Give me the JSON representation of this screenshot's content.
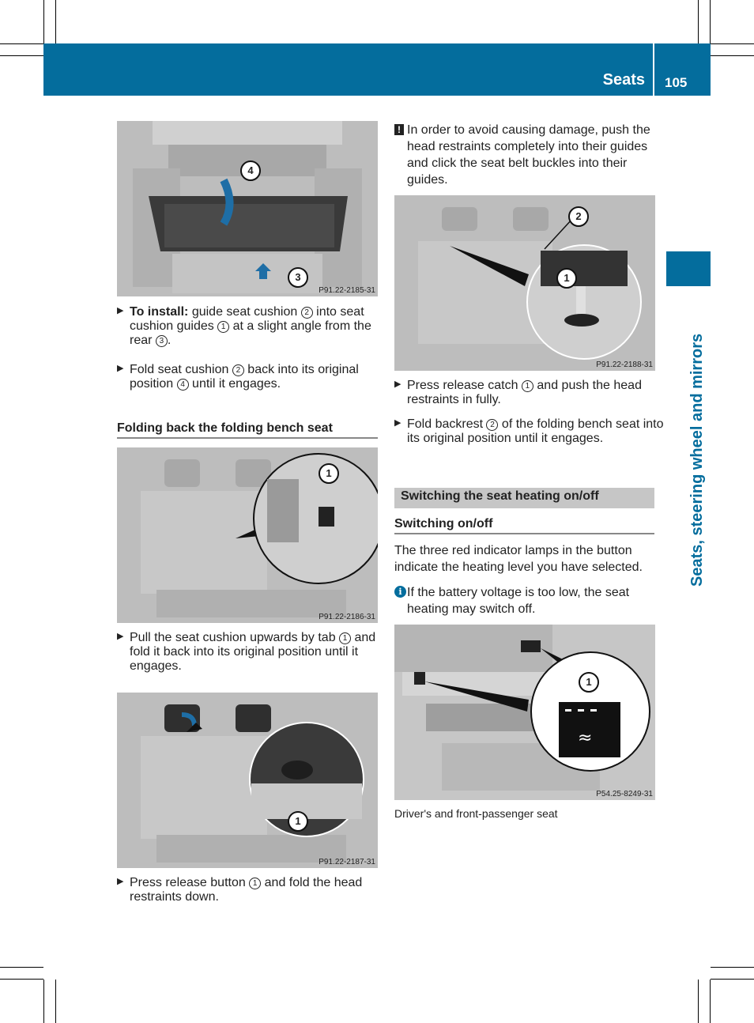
{
  "header": {
    "section_title": "Seats",
    "page_number": "105",
    "accent_color": "#046d9d"
  },
  "side_tab": {
    "chapter_label": "Seats, steering wheel and mirrors"
  },
  "left_column": {
    "figure1": {
      "code": "P91.22-2185-31",
      "callouts": [
        "4",
        "3"
      ],
      "description": "Luggage compartment with seat cushion being installed; curved blue arrow and upward blue arrow"
    },
    "install_steps": [
      {
        "bold_prefix": "To install:",
        "parts": [
          " guide seat cushion ",
          "2",
          " into seat cushion guides ",
          "1",
          " at a slight angle from the rear ",
          "3",
          "."
        ]
      },
      {
        "parts": [
          "Fold seat cushion ",
          "2",
          " back into its original position ",
          "4",
          " until it engages."
        ]
      }
    ],
    "heading_folding_back": "Folding back the folding bench seat",
    "figure2": {
      "code": "P91.22-2186-31",
      "callouts": [
        "1"
      ],
      "description": "Rear bench seat with magnified inset of tab"
    },
    "pull_step": {
      "parts": [
        "Pull the seat cushion upwards by tab ",
        "1",
        " and fold it back into its original position until it engages."
      ]
    },
    "figure3": {
      "code": "P91.22-2187-31",
      "callouts": [
        "1"
      ],
      "description": "Head restraint with blue arrow and magnified inset of release button"
    },
    "press_button_step": {
      "parts": [
        "Press release button ",
        "1",
        " and fold the head restraints down."
      ]
    }
  },
  "right_column": {
    "warning": {
      "icon": "exclamation-icon",
      "text": "In order to avoid causing damage, push the head restraints completely into their guides and click the seat belt buckles into their guides."
    },
    "figure4": {
      "code": "P91.22-2188-31",
      "callouts": [
        "2",
        "1"
      ],
      "description": "Rear bench with magnified inset of head restraint release catch"
    },
    "steps": [
      {
        "parts": [
          "Press release catch ",
          "1",
          " and push the head restraints in fully."
        ]
      },
      {
        "parts": [
          "Fold backrest ",
          "2",
          " of the folding bench seat into its original position until it engages."
        ]
      }
    ],
    "section_heading": "Switching the seat heating on/off",
    "subheading": "Switching on/off",
    "body_text": "The three red indicator lamps in the button indicate the heating level you have selected.",
    "info_note": {
      "icon": "info-icon",
      "text": "If the battery voltage is too low, the seat heating may switch off."
    },
    "figure5": {
      "code": "P54.25-8249-31",
      "callouts": [
        "1"
      ],
      "description": "Center console with magnified seat heating button"
    },
    "figure5_caption": "Driver's and front-passenger seat"
  }
}
